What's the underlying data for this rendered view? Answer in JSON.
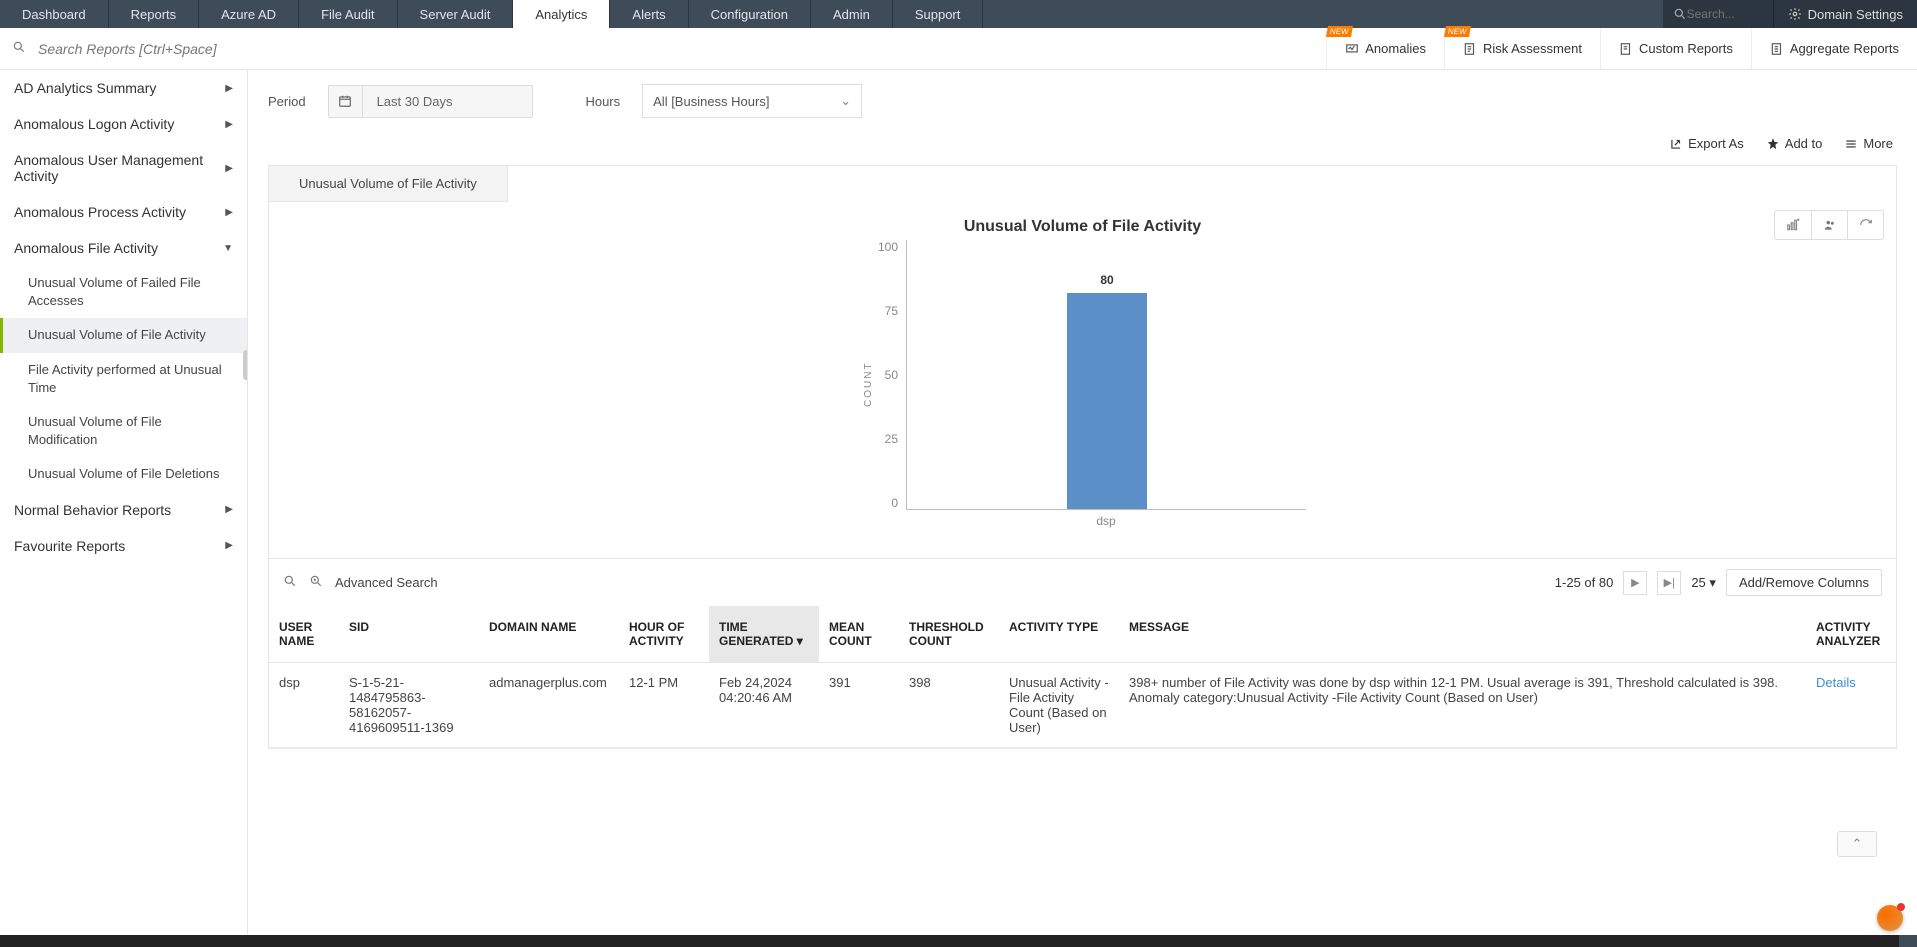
{
  "topnav": {
    "tabs": [
      "Dashboard",
      "Reports",
      "Azure AD",
      "File Audit",
      "Server Audit",
      "Analytics",
      "Alerts",
      "Configuration",
      "Admin",
      "Support"
    ],
    "active_index": 5,
    "search_placeholder": "Search...",
    "domain_settings": "Domain Settings"
  },
  "subheader": {
    "search_placeholder": "Search Reports [Ctrl+Space]",
    "links": {
      "anomalies": "Anomalies",
      "risk": "Risk Assessment",
      "custom": "Custom Reports",
      "aggregate": "Aggregate Reports",
      "new_tag": "NEW"
    }
  },
  "sidebar": {
    "items": [
      {
        "label": "AD Analytics Summary",
        "expandable": true,
        "open": false
      },
      {
        "label": "Anomalous Logon Activity",
        "expandable": true,
        "open": false
      },
      {
        "label": "Anomalous User Management Activity",
        "expandable": true,
        "open": false
      },
      {
        "label": "Anomalous Process Activity",
        "expandable": true,
        "open": false
      },
      {
        "label": "Anomalous File Activity",
        "expandable": true,
        "open": true
      },
      {
        "label": "Normal Behavior Reports",
        "expandable": true,
        "open": false
      },
      {
        "label": "Favourite Reports",
        "expandable": true,
        "open": false
      }
    ],
    "subitems": [
      "Unusual Volume of Failed File Accesses",
      "Unusual Volume of File Activity",
      "File Activity performed at Unusual Time",
      "Unusual Volume of File Modification",
      "Unusual Volume of File Deletions"
    ],
    "active_sub": 1
  },
  "filters": {
    "period_label": "Period",
    "period_value": "Last 30 Days",
    "hours_label": "Hours",
    "hours_value": "All [Business Hours]"
  },
  "toolbar": {
    "export": "Export As",
    "addto": "Add to",
    "more": "More"
  },
  "tab": {
    "title": "Unusual Volume of File Activity"
  },
  "chart_data": {
    "type": "bar",
    "title": "Unusual Volume of File Activity",
    "ylabel": "COUNT",
    "ylim": [
      0,
      100
    ],
    "yticks": [
      0,
      25,
      50,
      75,
      100
    ],
    "categories": [
      "dsp"
    ],
    "values": [
      80
    ]
  },
  "table": {
    "toolbar": {
      "advanced": "Advanced Search",
      "range": "1-25 of 80",
      "page_size": "25",
      "add_remove": "Add/Remove Columns"
    },
    "columns": [
      "USER NAME",
      "SID",
      "DOMAIN NAME",
      "HOUR OF ACTIVITY",
      "TIME GENERATED",
      "MEAN COUNT",
      "THRESHOLD COUNT",
      "ACTIVITY TYPE",
      "MESSAGE",
      "ACTIVITY ANALYZER"
    ],
    "sorted_col_index": 4,
    "rows": [
      {
        "user": "dsp",
        "sid": "S-1-5-21-1484795863-58162057-4169609511-1369",
        "domain": "admanagerplus.com",
        "hour": "12-1 PM",
        "time": "Feb 24,2024 04:20:46 AM",
        "mean": "391",
        "threshold": "398",
        "activity": "Unusual Activity -File Activity Count (Based on User)",
        "message": "398+ number of File Activity was done by dsp within 12-1 PM. Usual average is 391, Threshold calculated is 398. Anomaly category:Unusual Activity -File Activity Count (Based on User)",
        "analyzer": "Details"
      }
    ]
  }
}
